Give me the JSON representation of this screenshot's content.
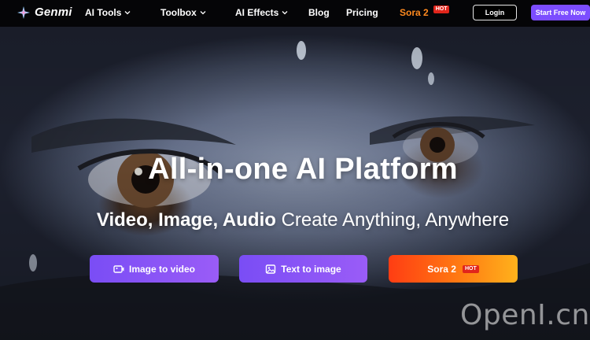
{
  "nav": {
    "brand": "Genmi",
    "ai_tools": "AI Tools",
    "toolbox": "Toolbox",
    "ai_effects": "AI Effects",
    "blog": "Blog",
    "pricing": "Pricing",
    "sora": "Sora 2",
    "sora_badge": "HOT",
    "login": "Login",
    "start": "Start Free Now"
  },
  "hero": {
    "title": "All-in-one AI Platform",
    "subtitle_bold": "Video, Image, Audio",
    "subtitle_rest": " Create Anything, Anywhere",
    "buttons": {
      "image_to_video": "Image to video",
      "text_to_image": "Text to image",
      "sora": "Sora 2",
      "sora_badge": "HOT"
    }
  },
  "watermark": "OpenI.cn",
  "colors": {
    "accent": "#7c4dff",
    "cta_purple": "#8b55f6",
    "cta_orange": "#ff6a12",
    "sora_nav": "#ff8a1f",
    "hot_badge": "#e1251b"
  },
  "icons": [
    "sparkle-logo-icon",
    "chevron-down-icon",
    "image-video-icon",
    "image-icon"
  ]
}
